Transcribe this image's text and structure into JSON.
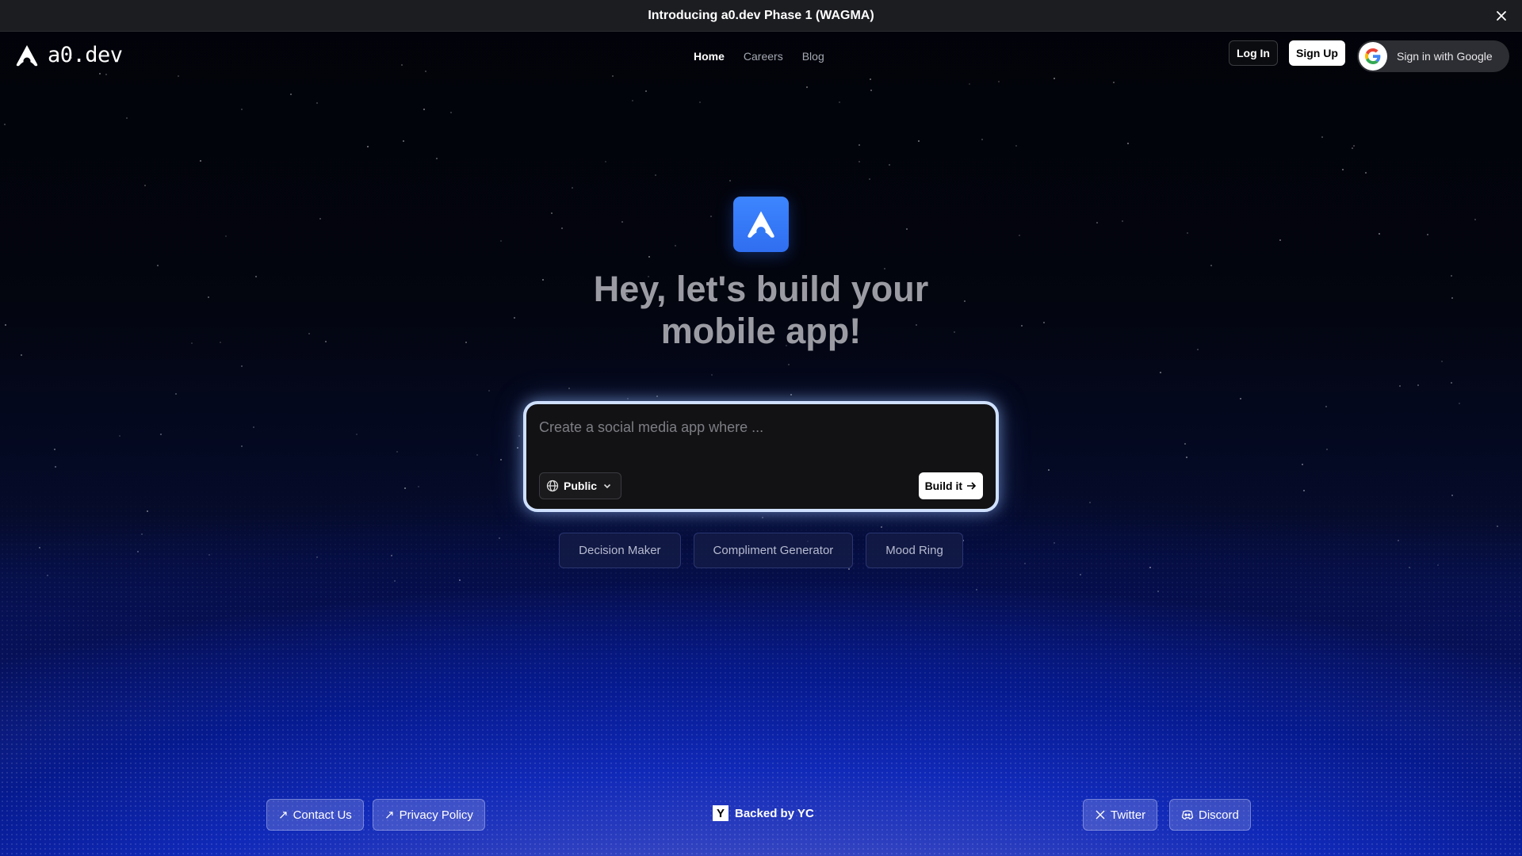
{
  "announcement": {
    "text": "Introducing a0.dev Phase 1 (WAGMA)"
  },
  "brand": {
    "name": "a0.dev"
  },
  "nav": {
    "items": [
      "Home",
      "Careers",
      "Blog"
    ],
    "active": "Home"
  },
  "auth": {
    "login": "Log In",
    "signup": "Sign Up",
    "google": "Sign in with Google"
  },
  "hero": {
    "line1": "Hey, let's build your",
    "line2": "mobile app!"
  },
  "prompt": {
    "placeholder": "Create a social media app where ...",
    "visibility": "Public",
    "build_label": "Build it"
  },
  "suggestions": [
    "Decision Maker",
    "Compliment Generator",
    "Mood Ring"
  ],
  "footer": {
    "contact": "Contact Us",
    "privacy": "Privacy Policy",
    "backed": "Backed by YC",
    "yc_letter": "Y",
    "twitter": "Twitter",
    "discord": "Discord"
  },
  "colors": {
    "accent_blue": "#3d85ff",
    "glow": "#cfe0ff"
  }
}
